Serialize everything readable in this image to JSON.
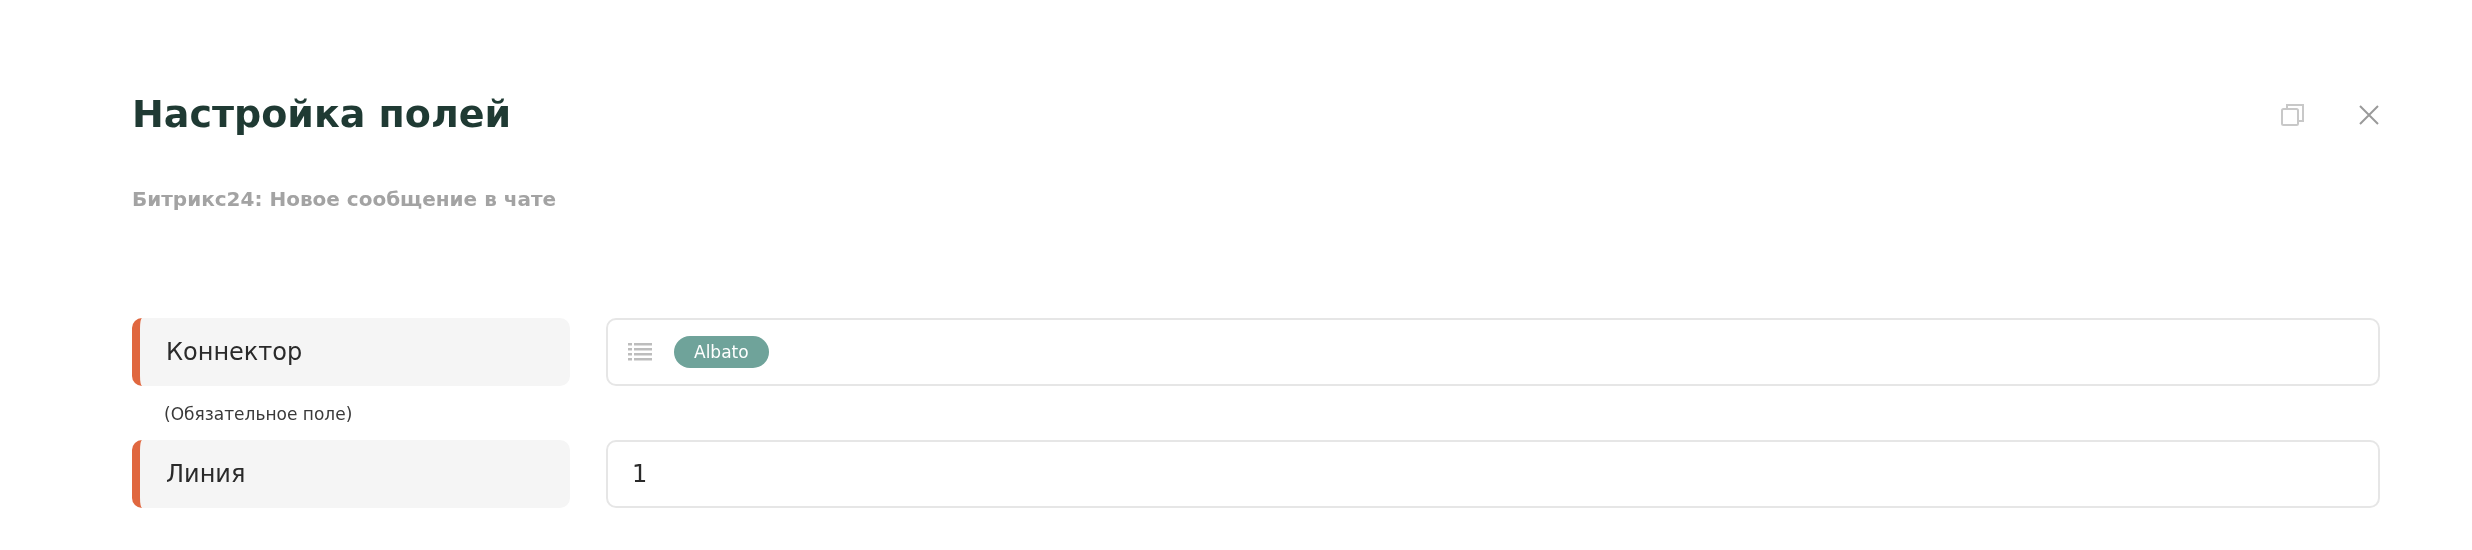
{
  "dialog": {
    "title": "Настройка полей",
    "subtitle": "Битрикс24: Новое сообщение в чате"
  },
  "fields": [
    {
      "label": "Коннектор",
      "hint": "(Обязательное поле)",
      "kind": "tags",
      "tags": [
        "Albato"
      ]
    },
    {
      "label": "Линия",
      "kind": "text",
      "value": "1"
    }
  ]
}
